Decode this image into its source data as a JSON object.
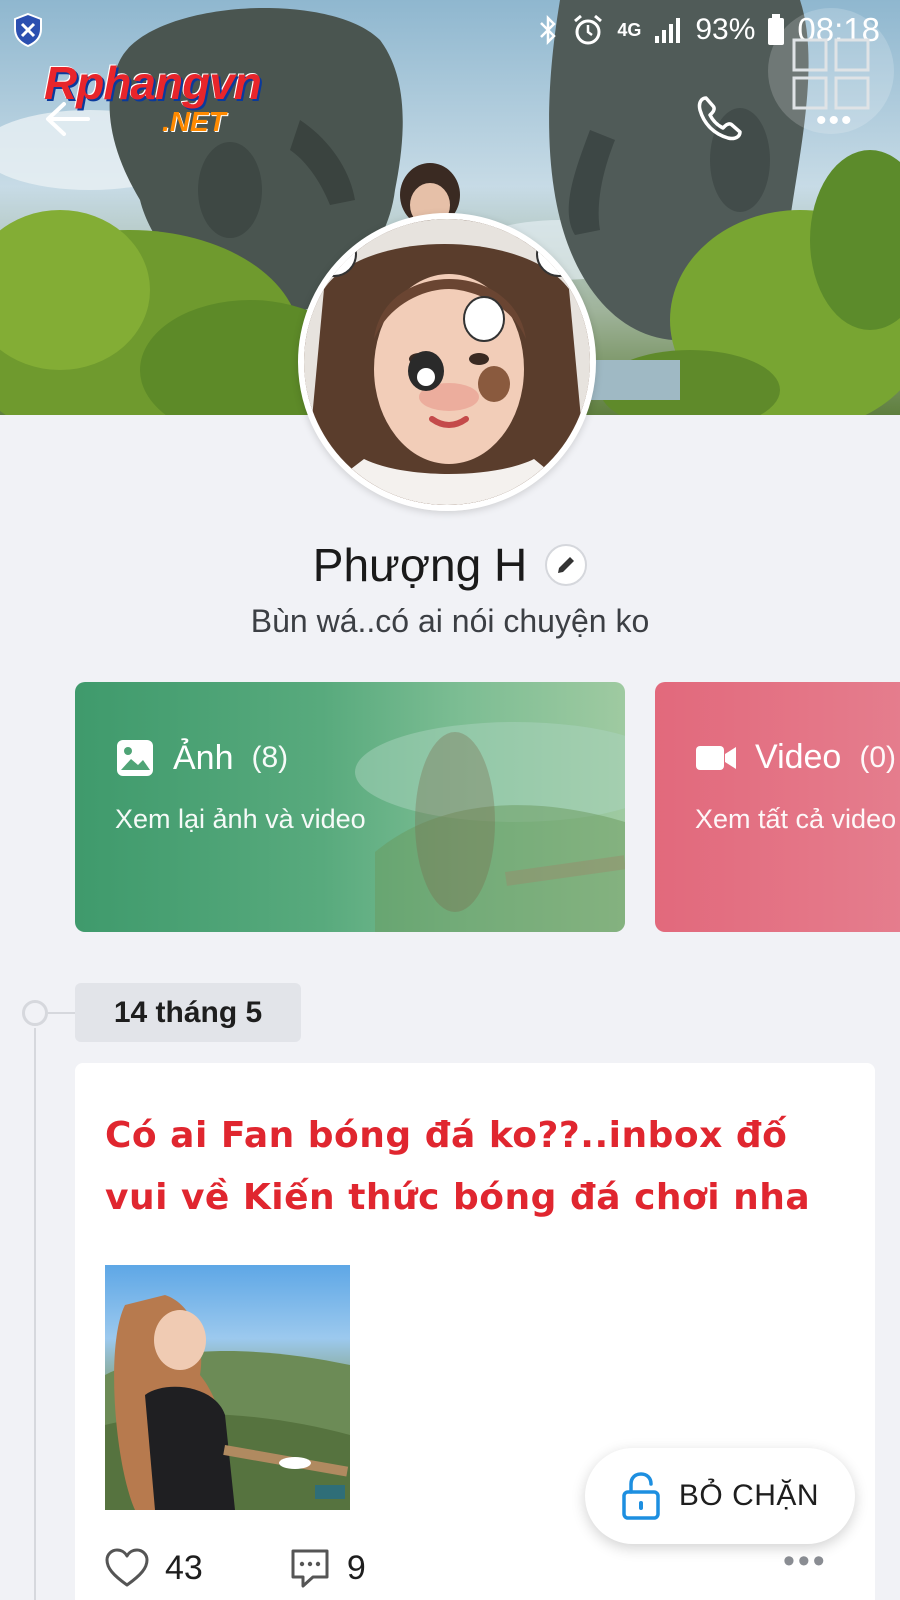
{
  "status_bar": {
    "battery": "93%",
    "time": "08:18",
    "network": "4G",
    "icons": [
      "shield-icon",
      "bluetooth-icon",
      "alarm-icon",
      "signal-icon",
      "battery-icon"
    ]
  },
  "watermark": {
    "main": "Rphangvn",
    "sub": ".NET"
  },
  "header": {
    "icons": [
      "back-arrow-icon",
      "phone-icon",
      "grid-icon",
      "more-icon"
    ]
  },
  "profile": {
    "name": "Phượng H",
    "status": "Bùn wá..có ai nói chuyện ko"
  },
  "media_cards": [
    {
      "title": "Ảnh",
      "count": "(8)",
      "subtitle": "Xem lại ảnh và video",
      "color": "#4fa476",
      "icon": "image-icon"
    },
    {
      "title": "Video",
      "count": "(0)",
      "subtitle": "Xem tất cả video",
      "color": "#e36d80",
      "icon": "video-icon"
    }
  ],
  "timeline": {
    "date": "14 tháng 5"
  },
  "post": {
    "text": "Có ai Fan bóng đá ko??..inbox đố vui về Kiến thức bóng đá chơi nha",
    "likes": "43",
    "comments": "9",
    "text_color": "#e0262f"
  },
  "unblock": {
    "label": "BỎ CHẶN",
    "icon": "unlock-icon"
  }
}
